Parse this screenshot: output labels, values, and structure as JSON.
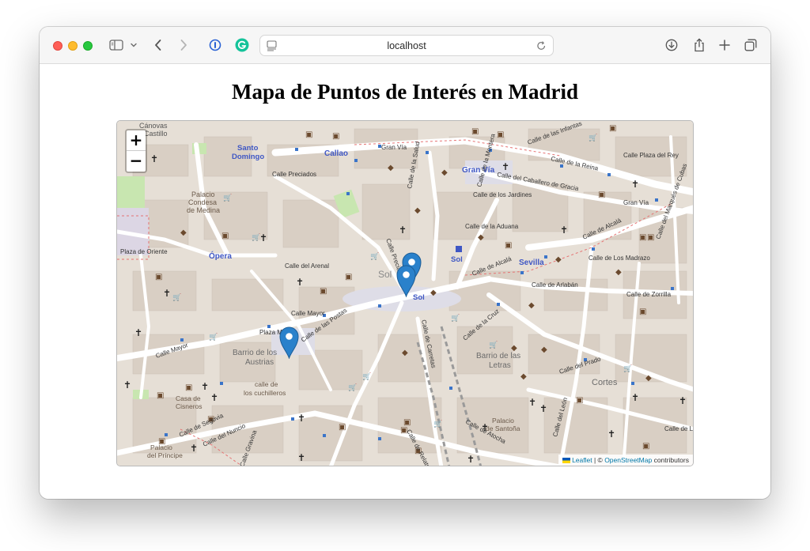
{
  "browser": {
    "url": "localhost",
    "buttons": [
      "sidebar",
      "back",
      "forward",
      "downloads",
      "share",
      "new-tab",
      "tab-overview"
    ]
  },
  "page": {
    "title": "Mapa de Puntos de Interés en Madrid"
  },
  "map": {
    "zoom_in_label": "+",
    "zoom_out_label": "−",
    "attribution": {
      "leaflet": "Leaflet",
      "separator": "| ©",
      "osm": "OpenStreetMap",
      "suffix": "contributors"
    },
    "labels": {
      "canovas": "Cánovas",
      "castillo": "Castillo",
      "santo": "Santo",
      "domingo": "Domingo",
      "callao": "Callao",
      "gran_via_station": "Gran Vía",
      "gran_via": "Gran Vía",
      "calle_preciados": "Calle Preciados",
      "calle_la_salud": "Calle de la Salud",
      "calle_montera": "Calle de la Montera",
      "calle_infantas": "Calle de las Infantas",
      "calle_reina": "Calle de la Reina",
      "calle_plaza_del_rey": "Calle Plaza del Rey",
      "calle_caballero": "Calle del Caballero de Gracia",
      "calle_jardines": "Calle de los Jardines",
      "calle_aduana": "Calle de la Aduana",
      "calle_alcala": "Calle de Alcalá",
      "calle_alcala_2": "Calle de Alcalá",
      "palacio_condesa_1": "Palacio",
      "palacio_condesa_2": "Condesa",
      "palacio_condesa_3": "de Medina",
      "plaza_oriente": "Plaza de Oriente",
      "opera": "Ópera",
      "calle_arenal": "Calle del Arenal",
      "sol": "Sol",
      "sol_metro": "Sol",
      "sol_station": "Sol",
      "sevilla": "Sevilla",
      "calle_los_madrazo": "Calle de Los Madrazo",
      "calle_arlaban": "Calle de Arlabán",
      "calle_zorrilla": "Calle de Zorrilla",
      "calle_mayor": "Calle Mayor",
      "calle_mayor_2": "Calle Mayor",
      "calle_postas": "Calle de las Postas",
      "plaza_mayor": "Plaza M",
      "barrio_austrias_1": "Barrio de los",
      "barrio_austrias_2": "Austrias",
      "calle_carretas": "Calle de Carretas",
      "calle_cruz": "Calle de la Cruz",
      "barrio_letras_1": "Barrio de las",
      "barrio_letras_2": "Letras",
      "calle_prado": "Calle del Prado",
      "cortes": "Cortes",
      "calle_cuchilleros_1": "calle de",
      "calle_cuchilleros_2": "los cuchilleros",
      "casa_cisneros_1": "Casa de",
      "casa_cisneros_2": "Cisneros",
      "calle_segovia": "Calle de Segovia",
      "calle_nuncio": "Calle del Nuncio",
      "palacio_santona_1": "Palacio",
      "palacio_santona_2": "de Santoña",
      "calle_atocha": "Calle de Atocha",
      "calle_relatores": "Calle de Relatores",
      "calle_leon": "Calle del León",
      "palacio_principe_1": "Palacio",
      "palacio_principe_2": "del Príncipe",
      "calle_lope": "Calle de Lope",
      "gran_via_east": "Gran Vía",
      "calle_marques_cubas": "Calle del Marqués de Cubas",
      "calle_precia_vert": "Calle Preciados",
      "calle_gravina": "Calle Gravina"
    }
  },
  "colors": {
    "land": "#efe9e1",
    "buildings": "#d8cfc5",
    "roads": "#ffffff",
    "pedestrian": "#dddde8",
    "park": "#c8e6b0",
    "marker": "#2a81cb",
    "metro_label": "#3f57c4"
  }
}
